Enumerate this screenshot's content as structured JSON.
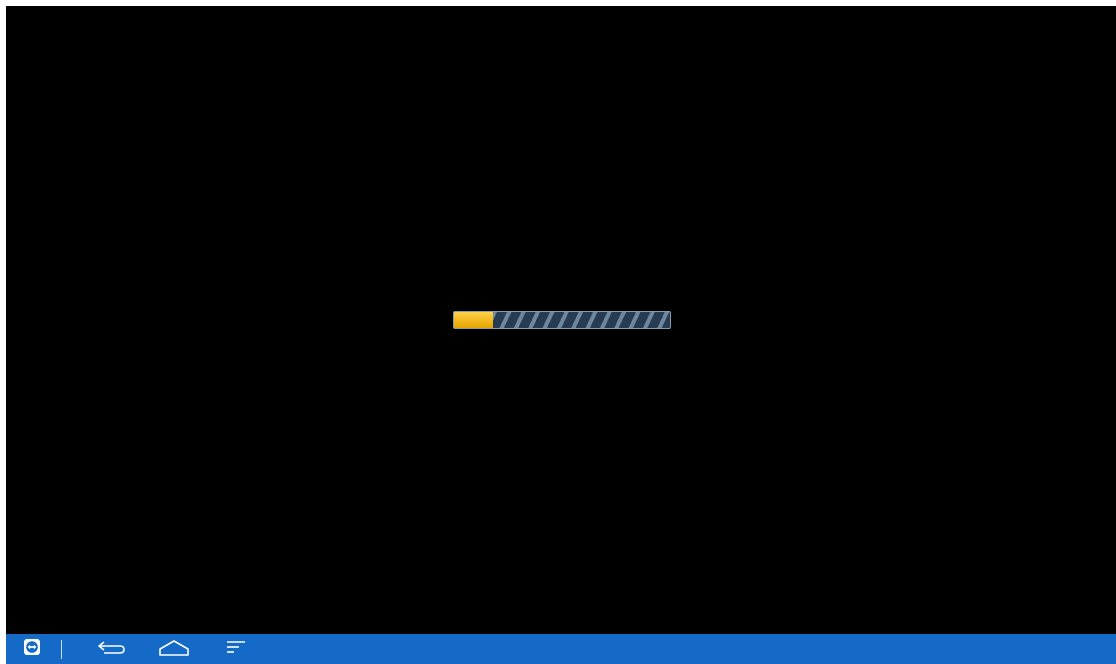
{
  "screen": {
    "background": "#000000"
  },
  "loader": {
    "progress_fraction": 0.18,
    "fill_color": "#f5b800",
    "track_color": "#273b52",
    "stripe_color": "#6d879f"
  },
  "taskbar": {
    "background": "#1569c7",
    "buttons": [
      {
        "name": "app-switcher-button",
        "icon": "teamviewer-icon"
      },
      {
        "name": "back-button",
        "icon": "back-arrow-icon"
      },
      {
        "name": "home-button",
        "icon": "home-icon"
      },
      {
        "name": "recent-apps-button",
        "icon": "menu-lines-icon"
      }
    ]
  }
}
